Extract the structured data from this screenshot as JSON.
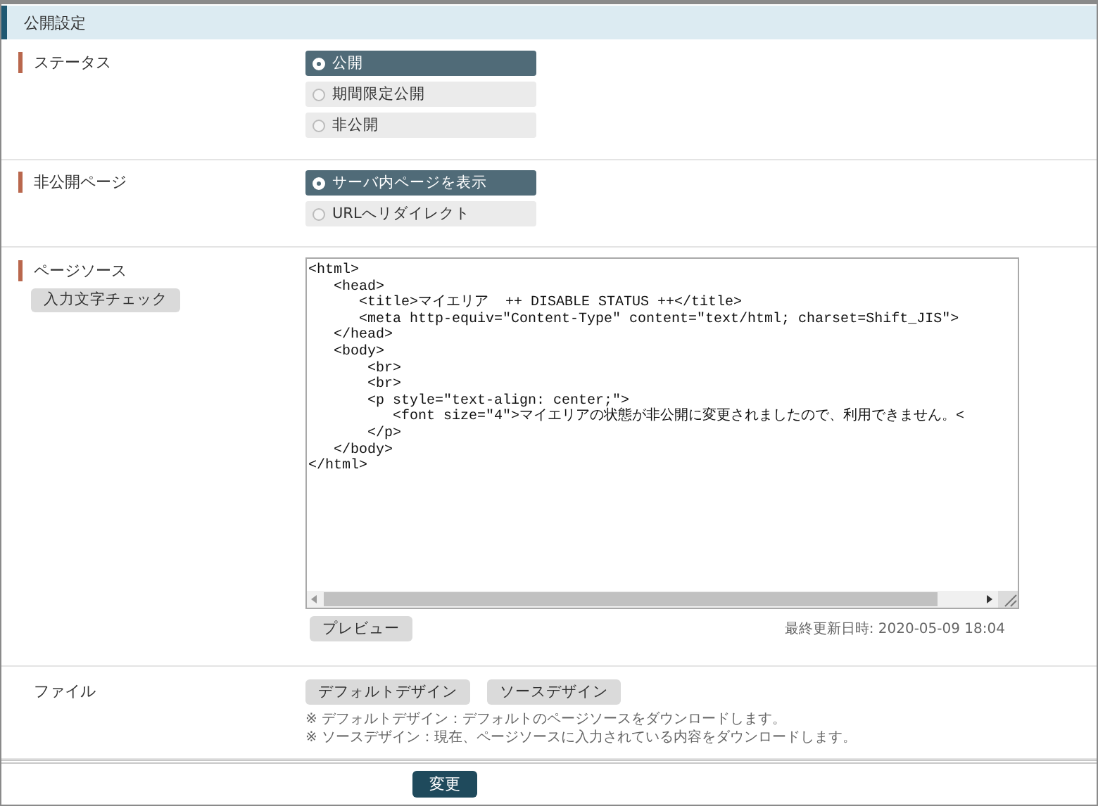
{
  "section_title": "公開設定",
  "status": {
    "label": "ステータス",
    "marked": true,
    "options": [
      {
        "label": "公開",
        "selected": true
      },
      {
        "label": "期間限定公開",
        "selected": false
      },
      {
        "label": "非公開",
        "selected": false
      }
    ]
  },
  "private_page": {
    "label": "非公開ページ",
    "marked": true,
    "options": [
      {
        "label": "サーバ内ページを表示",
        "selected": true
      },
      {
        "label": "URLへリダイレクト",
        "selected": false
      }
    ]
  },
  "page_source": {
    "label": "ページソース",
    "marked": true,
    "check_button": "入力文字チェック",
    "code_lines": [
      "<html>",
      "   <head>",
      "      <title>マイエリア  ++ DISABLE STATUS ++</title>",
      "      <meta http-equiv=\"Content-Type\" content=\"text/html; charset=Shift_JIS\">",
      "   </head>",
      "   <body>",
      "       <br>",
      "       <br>",
      "       <p style=\"text-align: center;\">",
      "          <font size=\"4\">マイエリアの状態が非公開に変更されましたので、利用できません。<",
      "       </p>",
      "   </body>",
      "</html>"
    ],
    "preview_button": "プレビュー",
    "last_updated": "最終更新日時: 2020-05-09 18:04"
  },
  "file": {
    "label": "ファイル",
    "marked": false,
    "buttons": [
      "デフォルトデザイン",
      "ソースデザイン"
    ],
    "notes": [
      "※ デフォルトデザイン：デフォルトのページソースをダウンロードします。",
      "※ ソースデザイン：現在、ページソースに入力されている内容をダウンロードします。"
    ]
  },
  "submit_button": "変更"
}
